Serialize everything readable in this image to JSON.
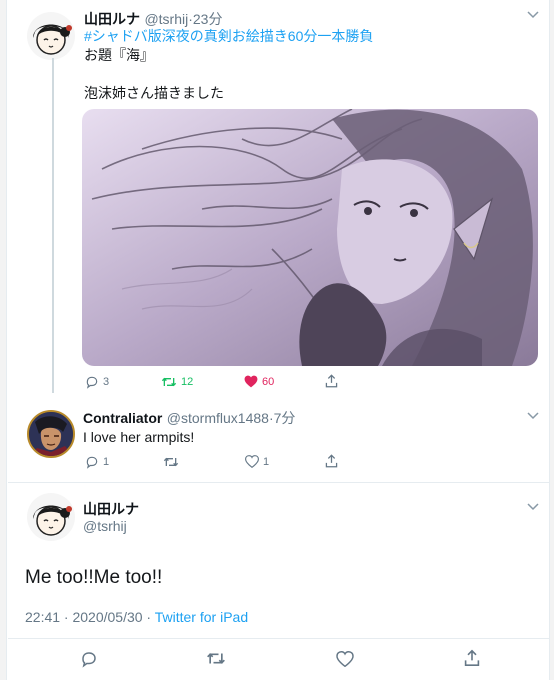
{
  "tweet1": {
    "name": "山田ルナ",
    "handle": "@tsrhij",
    "time": "·23分",
    "hashtag": "#シャドバ版深夜の真剣お絵描き60分一本勝負",
    "line1": "お題『海』",
    "line2": "泡沫姉さん描きました",
    "image_icon": "anime-illustration",
    "replies": "3",
    "retweets": "12",
    "likes": "60"
  },
  "tweet2": {
    "name": "Contraliator",
    "handle": "@stormflux1488",
    "time": "·7分",
    "text": "I love her armpits!",
    "replies": "1",
    "likes": "1"
  },
  "tweet3": {
    "name": "山田ルナ",
    "handle": "@tsrhij",
    "text": "Me too!!Me too!!",
    "date": "22:41 · 2020/05/30 · ",
    "source": "Twitter for iPad"
  },
  "colors": {
    "link": "#1da1f2",
    "retweet": "#17bf63",
    "like": "#e0245e",
    "muted": "#657786"
  }
}
